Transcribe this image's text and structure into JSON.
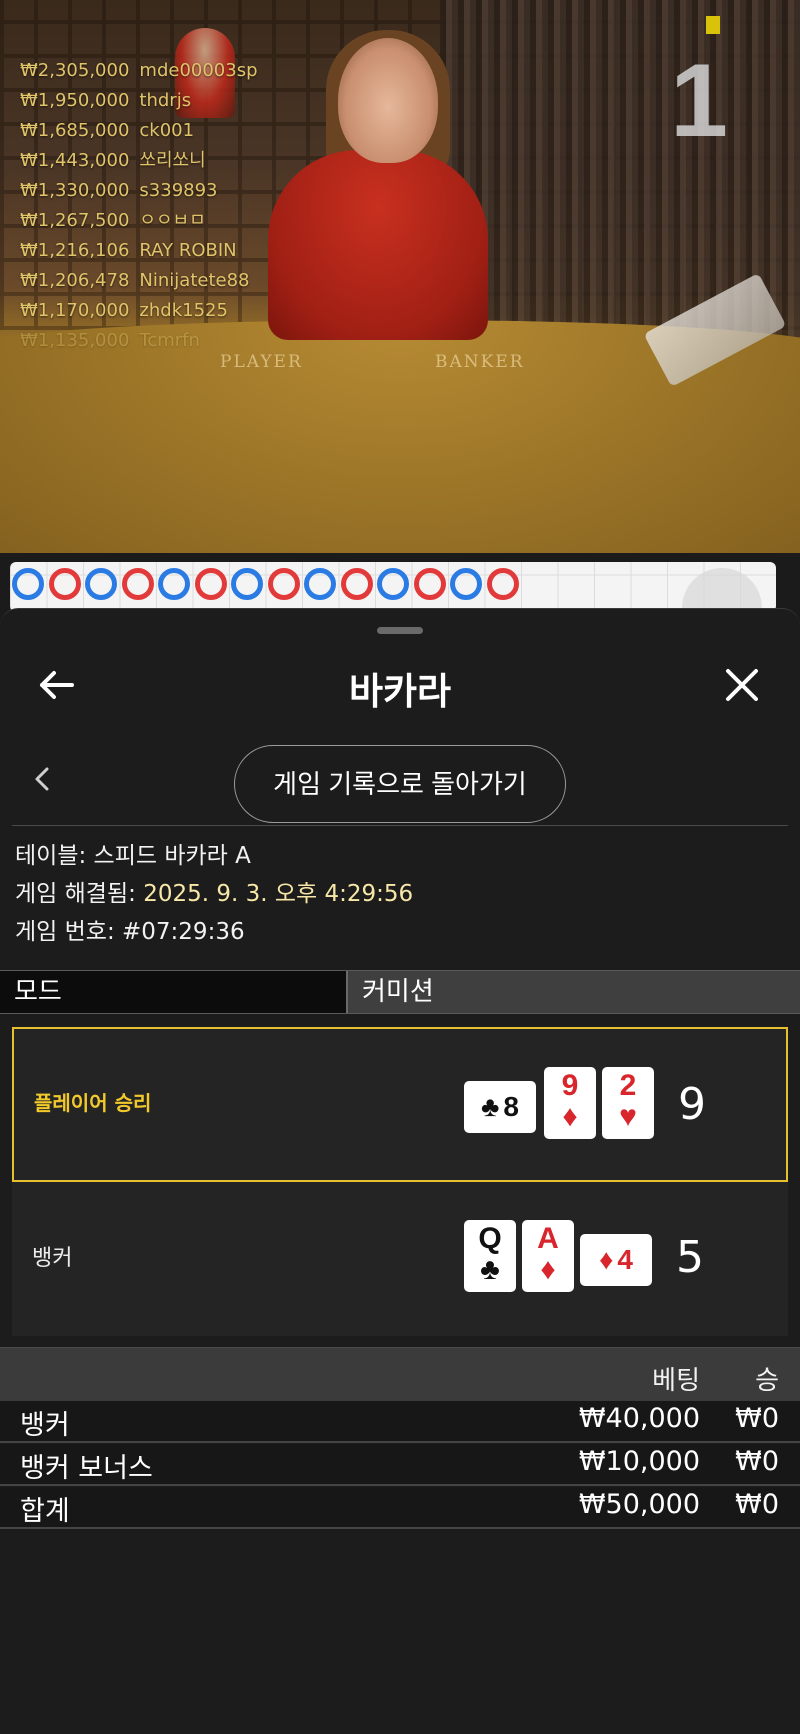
{
  "video": {
    "round_number": "1",
    "table_words": [
      "PLAYER",
      "BANKER"
    ],
    "leaderboard": [
      {
        "amount": "₩2,305,000",
        "name": "mde00003sp"
      },
      {
        "amount": "₩1,950,000",
        "name": "thdrjs"
      },
      {
        "amount": "₩1,685,000",
        "name": "ck001"
      },
      {
        "amount": "₩1,443,000",
        "name": "쏘리쏘니"
      },
      {
        "amount": "₩1,330,000",
        "name": "s339893"
      },
      {
        "amount": "₩1,267,500",
        "name": "ㅇㅇㅂㅁ"
      },
      {
        "amount": "₩1,216,106",
        "name": "RAY ROBIN"
      },
      {
        "amount": "₩1,206,478",
        "name": "Ninijatete88"
      },
      {
        "amount": "₩1,170,000",
        "name": "zhdk1525"
      },
      {
        "amount": "₩1,135,000",
        "name": "Tcmrfn"
      }
    ]
  },
  "road": {
    "top_row": [
      "blue",
      "red",
      "blue",
      "red",
      "blue",
      "red",
      "blue",
      "red",
      "blue",
      "red",
      "blue",
      "red",
      "blue",
      "red"
    ],
    "colors": {
      "blue": "#2a7be4",
      "red": "#e23a3a"
    }
  },
  "sheet": {
    "title": "바카라",
    "back_icon": "arrow-left-icon",
    "close_icon": "close-icon",
    "history_button": "게임 기록으로 돌아가기",
    "info": {
      "table_label": "테이블:",
      "table_value": "스피드 바카라 A",
      "resolved_label": "게임 해결됨:",
      "resolved_value": "2025. 9. 3. 오후 4:29:56",
      "number_label": "게임 번호:",
      "number_value": "#07:29:36"
    },
    "mode": {
      "label": "모드",
      "value": "커미션"
    },
    "hands": [
      {
        "label": "플레이어 승리",
        "winner": true,
        "score": "9",
        "cards": [
          {
            "rank": "8",
            "suit": "♣",
            "color": "black",
            "sideways": true
          },
          {
            "rank": "9",
            "suit": "♦",
            "color": "red",
            "sideways": false
          },
          {
            "rank": "2",
            "suit": "♥",
            "color": "red",
            "sideways": false
          }
        ]
      },
      {
        "label": "뱅커",
        "winner": false,
        "score": "5",
        "cards": [
          {
            "rank": "Q",
            "suit": "♣",
            "color": "black",
            "sideways": false
          },
          {
            "rank": "A",
            "suit": "♦",
            "color": "red",
            "sideways": false
          },
          {
            "rank": "4",
            "suit": "♦",
            "color": "red",
            "sideways": true
          }
        ]
      }
    ],
    "bets": {
      "col_bet": "베팅",
      "col_win": "승",
      "rows": [
        {
          "name": "뱅커",
          "amount": "₩40,000",
          "win": "₩0"
        },
        {
          "name": "뱅커 보너스",
          "amount": "₩10,000",
          "win": "₩0"
        },
        {
          "name": "합계",
          "amount": "₩50,000",
          "win": "₩0"
        }
      ]
    },
    "accent_color": "#e6c02e"
  }
}
